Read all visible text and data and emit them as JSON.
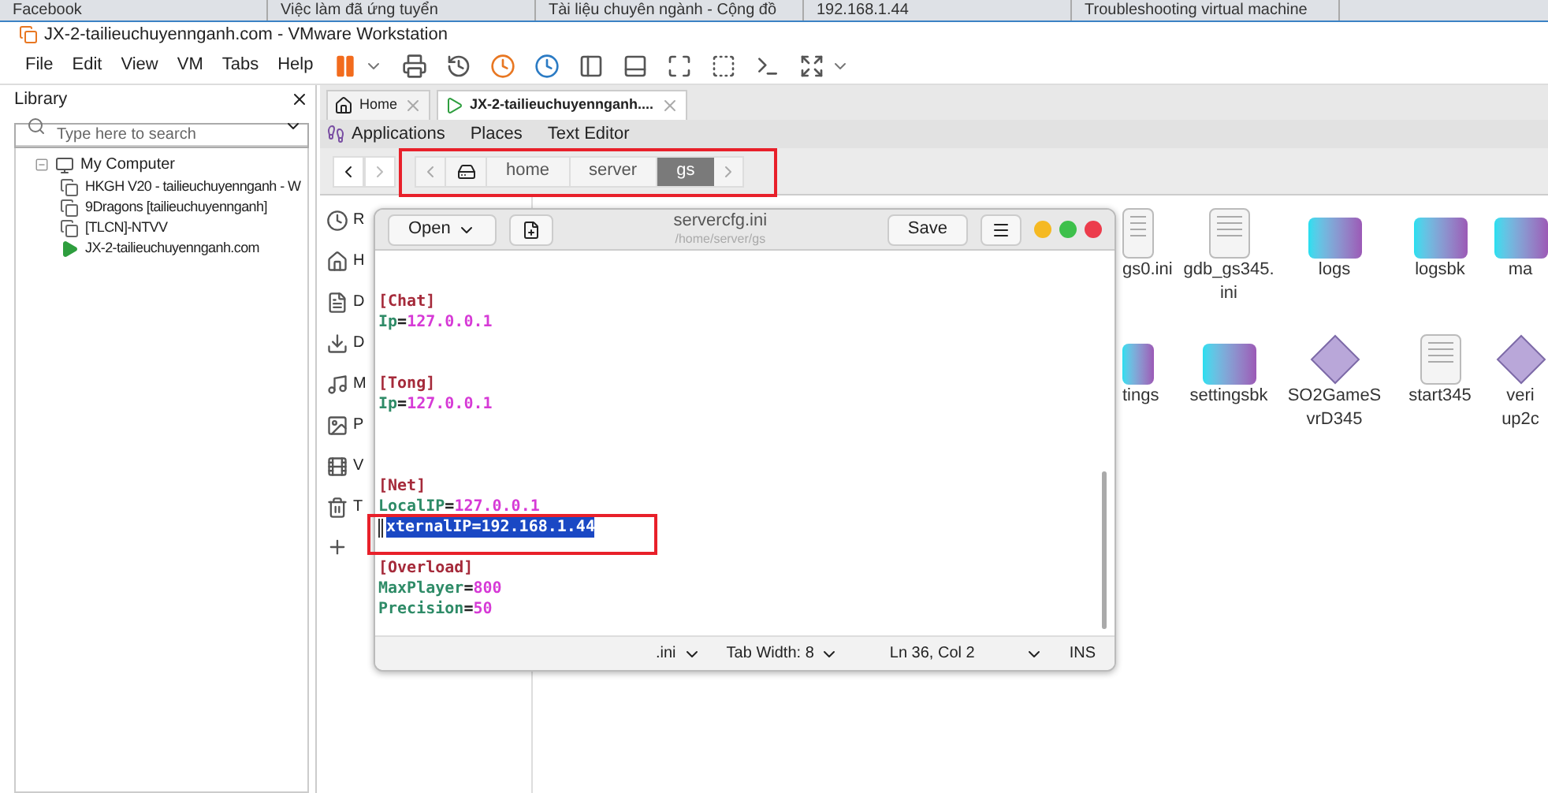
{
  "browser_tabs": [
    {
      "title": "Facebook"
    },
    {
      "title": "Việc làm đã ứng tuyển"
    },
    {
      "title": "Tài liệu chuyên ngành - Cộng đồ"
    },
    {
      "title": "192.168.1.44"
    },
    {
      "title": "Troubleshooting virtual machine"
    }
  ],
  "window": {
    "title": "JX-2-tailieuchuyennganh.com - VMware Workstation"
  },
  "menu": [
    "File",
    "Edit",
    "View",
    "VM",
    "Tabs",
    "Help"
  ],
  "library": {
    "title": "Library",
    "search": {
      "placeholder": "Type here to search"
    },
    "tree": [
      {
        "label": "My Computer",
        "expanded": true,
        "children": [
          {
            "label": "HKGH V20 - tailieuchuyennganh - W",
            "running": false
          },
          {
            "label": "9Dragons  [tailieuchuyennganh]",
            "running": false
          },
          {
            "label": "[TLCN]-NTVV",
            "running": false
          },
          {
            "label": "JX-2-tailieuchuyennganh.com",
            "running": true
          }
        ]
      }
    ]
  },
  "vm_tabs": [
    {
      "label": "Home",
      "selected": false
    },
    {
      "label": "JX-2-tailieuchuyennganh....",
      "selected": true
    }
  ],
  "gnome_bar": [
    "Applications",
    "Places",
    "Text Editor"
  ],
  "path_bar": [
    {
      "label": "home",
      "selected": false
    },
    {
      "label": "server",
      "selected": false
    },
    {
      "label": "gs",
      "selected": true
    }
  ],
  "sidebar": [
    {
      "kind": "recent",
      "label": "R"
    },
    {
      "kind": "home",
      "label": "H"
    },
    {
      "kind": "documents",
      "label": "D"
    },
    {
      "kind": "downloads",
      "label": "D"
    },
    {
      "kind": "music",
      "label": "M"
    },
    {
      "kind": "pictures",
      "label": "P"
    },
    {
      "kind": "videos",
      "label": "V"
    },
    {
      "kind": "trash",
      "label": "T"
    },
    {
      "kind": "other"
    }
  ],
  "files": [
    {
      "kind": "document",
      "lines": [
        "gs0.ini"
      ]
    },
    {
      "kind": "document",
      "lines": [
        "gdb_gs345.",
        "ini"
      ]
    },
    {
      "kind": "folder",
      "lines": [
        "logs"
      ]
    },
    {
      "kind": "folder",
      "lines": [
        "logsbk"
      ]
    },
    {
      "kind": "folder",
      "lines": [
        "ma"
      ]
    },
    {
      "kind": "folder",
      "lines": [
        "tings"
      ]
    },
    {
      "kind": "folder",
      "lines": [
        "settingsbk"
      ]
    },
    {
      "kind": "program",
      "lines": [
        "SO2GameS",
        "vrD345"
      ]
    },
    {
      "kind": "document",
      "lines": [
        "start345"
      ]
    },
    {
      "kind": "program",
      "lines": [
        "veri",
        "up2c"
      ]
    }
  ],
  "editor": {
    "title": "servercfg.ini",
    "path": "/home/server/gs",
    "open": "Open",
    "save": "Save",
    "lines": [
      {
        "kind": "blank"
      },
      {
        "kind": "blank"
      },
      {
        "kind": "section",
        "text": "[Chat]"
      },
      {
        "kind": "pair",
        "key": "Ip",
        "separator": "=",
        "value": "127.0.0.1",
        "selected": false
      },
      {
        "kind": "blank"
      },
      {
        "kind": "blank"
      },
      {
        "kind": "section",
        "text": "[Tong]"
      },
      {
        "kind": "pair",
        "key": "Ip",
        "separator": "=",
        "value": "127.0.0.1",
        "selected": false
      },
      {
        "kind": "blank"
      },
      {
        "kind": "blank"
      },
      {
        "kind": "blank"
      },
      {
        "kind": "section",
        "text": "[Net]"
      },
      {
        "kind": "pair",
        "key": "LocalIP",
        "separator": "=",
        "value": "127.0.0.1",
        "selected": false
      },
      {
        "kind": "pair",
        "key": "xternalIP",
        "separator": "=",
        "value": "192.168.1.44",
        "selected": true
      },
      {
        "kind": "blank"
      },
      {
        "kind": "section",
        "text": "[Overload]"
      },
      {
        "kind": "pair",
        "key": "MaxPlayer",
        "separator": "=",
        "value": "800",
        "selected": false
      },
      {
        "kind": "pair",
        "key": "Precision",
        "separator": "=",
        "value": "50",
        "selected": false
      }
    ],
    "status": {
      "language": ".ini",
      "tab_width": "Tab Width: 8",
      "position": "Ln 36, Col 2",
      "mode": "INS"
    }
  }
}
